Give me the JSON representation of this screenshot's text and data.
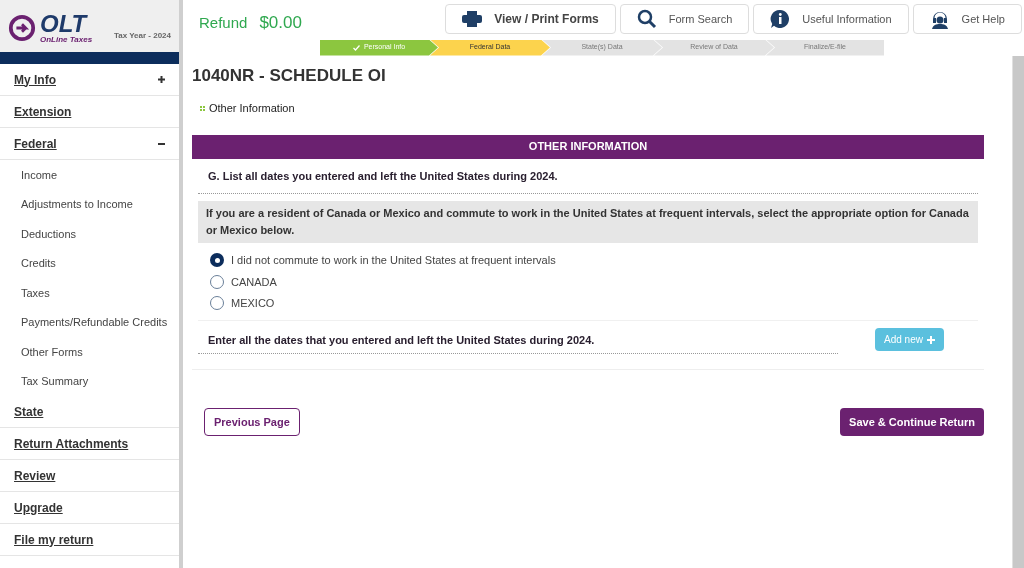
{
  "brand": {
    "logo": "OLT",
    "tagline": "OnLine Taxes",
    "tax_year": "Tax Year - 2024"
  },
  "refund": {
    "label": "Refund",
    "amount": "$0.00"
  },
  "toolbar": [
    {
      "kind": "print",
      "label": "View / Print Forms"
    },
    {
      "kind": "search",
      "label": "Form Search"
    },
    {
      "kind": "info",
      "label": "Useful Information"
    },
    {
      "kind": "help",
      "label": "Get Help"
    }
  ],
  "steps": [
    {
      "label": "Personal Info",
      "completed": true,
      "selected": false
    },
    {
      "label": "Federal Data",
      "completed": false,
      "selected": true
    },
    {
      "label": "State(s) Data",
      "completed": false,
      "selected": false
    },
    {
      "label": "Review of Data",
      "completed": false,
      "selected": false
    },
    {
      "label": "Finalize/E-file",
      "completed": false,
      "selected": false
    }
  ],
  "sidebar": [
    {
      "label": "My Info",
      "expanded": false
    },
    {
      "label": "Extension"
    },
    {
      "label": "Federal",
      "expanded": true,
      "children": [
        {
          "label": "Income"
        },
        {
          "label": "Adjustments to Income"
        },
        {
          "label": "Deductions"
        },
        {
          "label": "Credits"
        },
        {
          "label": "Taxes"
        },
        {
          "label": "Payments/Refundable Credits"
        },
        {
          "label": "Other Forms"
        },
        {
          "label": "Tax Summary"
        }
      ]
    },
    {
      "label": "State"
    },
    {
      "label": "Return Attachments"
    },
    {
      "label": "Review"
    },
    {
      "label": "Upgrade"
    },
    {
      "label": "File my return"
    }
  ],
  "page_title": "1040NR - SCHEDULE OI",
  "breadcrumb": "Other Information",
  "section": {
    "header": "OTHER INFORMATION",
    "question": "G. List all dates you entered and left the United States during 2024.",
    "note": "If you are a resident of Canada or Mexico and commute to work in the United States at frequent intervals, select the appropriate option for Canada or Mexico below.",
    "options": [
      {
        "label": "I did not commute to work in the United States at frequent intervals",
        "selected": true
      },
      {
        "label": "CANADA",
        "selected": false
      },
      {
        "label": "MEXICO",
        "selected": false
      }
    ],
    "dates_prompt": "Enter all the dates that you entered and left the United States during 2024.",
    "add_button": "Add new"
  },
  "buttons": {
    "previous": "Previous Page",
    "next": "Save & Continue Return"
  }
}
